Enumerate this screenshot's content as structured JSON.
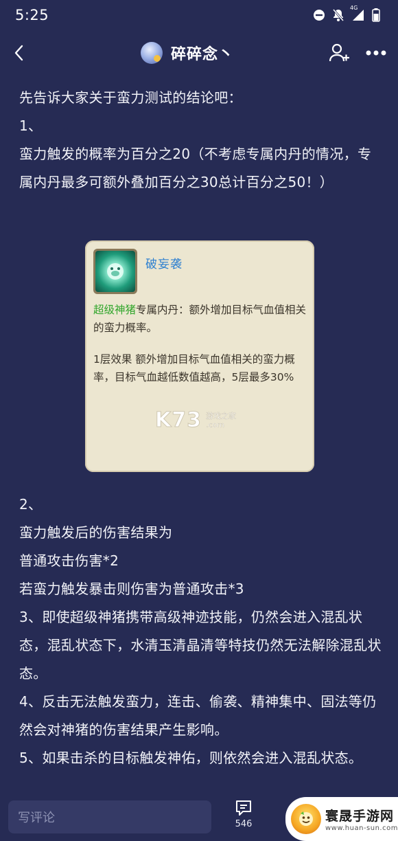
{
  "status_bar": {
    "time": "5:25",
    "network": "4G"
  },
  "nav": {
    "title": "碎碎念丶"
  },
  "post": {
    "paragraphs": [
      "先告诉大家关于蛮力测试的结论吧：",
      "1、",
      "蛮力触发的概率为百分之20（不考虑专属内丹的情况，专属内丹最多可额外叠加百分之30总计百分之50！）"
    ],
    "paragraphs_after": [
      "2、",
      "蛮力触发后的伤害结果为",
      "普通攻击伤害*2",
      "若蛮力触发暴击则伤害为普通攻击*3",
      "3、即使超级神猪携带高级神迹技能，仍然会进入混乱状态，混乱状态下，水清玉清晶清等特技仍然无法解除混乱状态。",
      "4、反击无法触发蛮力，连击、偷袭、精神集中、固法等仍然会对神猪的伤害结果产生影响。",
      "5、如果击杀的目标触发神佑，则依然会进入混乱状态。"
    ]
  },
  "skill_card": {
    "name": "破妄袭",
    "highlight": "超级神猪",
    "desc": "专属内丹：额外增加目标气血值相关的蛮力概率。",
    "effect": "1层效果  额外增加目标气血值相关的蛮力概率，目标气血越低数值越高，5层最多30%",
    "watermark_logo": "K73",
    "watermark_line1": "游戏之家",
    "watermark_line2": ".com"
  },
  "bottom_bar": {
    "comment_placeholder": "写评论",
    "comment_count": "546"
  },
  "brand": {
    "name": "寰晟手游网",
    "url": "www.huan-sun.com"
  },
  "colors": {
    "background": "#262b54",
    "card": "#ece6d0",
    "skill_name": "#2c7fd0",
    "highlight": "#2fa52a"
  }
}
